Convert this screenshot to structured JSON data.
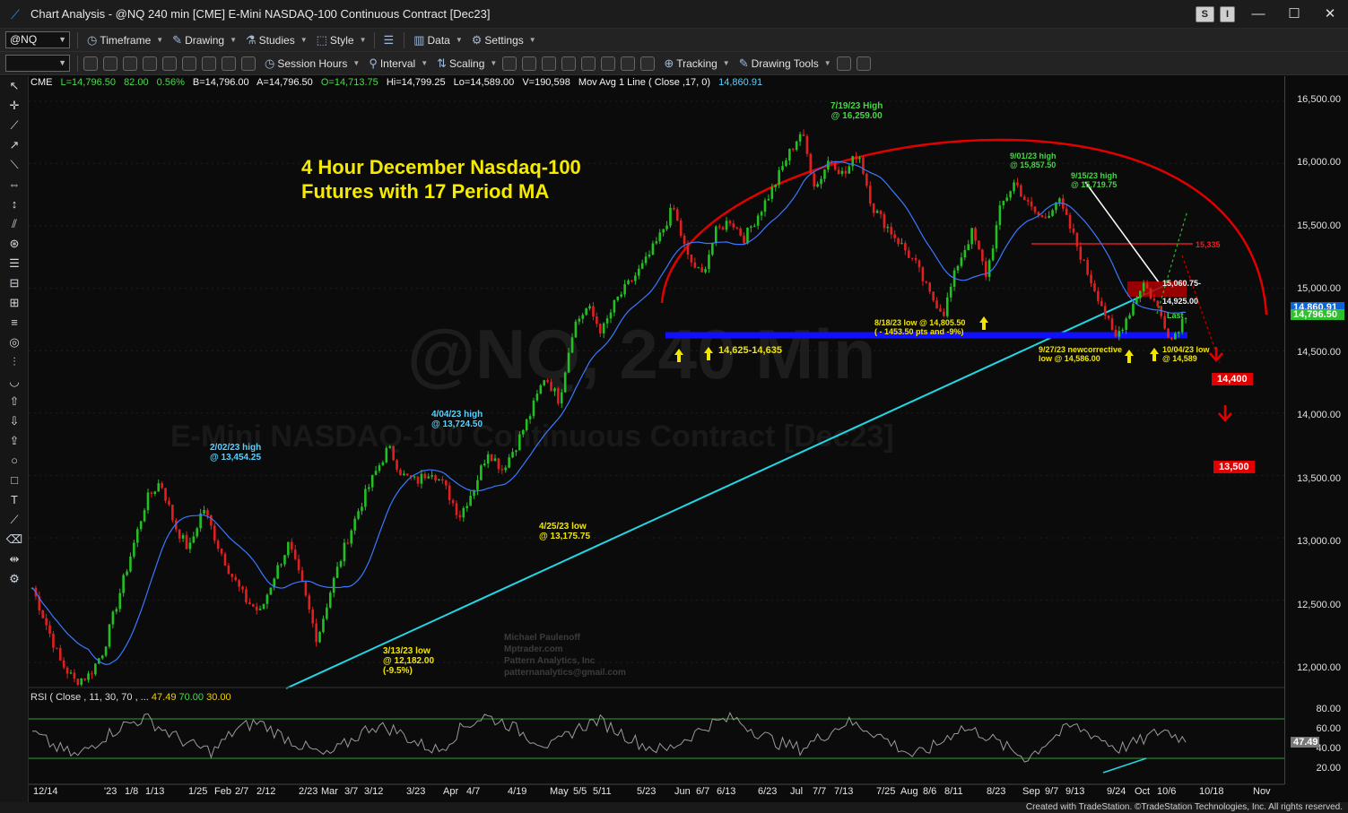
{
  "window": {
    "title": "Chart Analysis - @NQ 240 min [CME] E-Mini NASDAQ-100 Continuous Contract [Dec23]",
    "s_button": "S",
    "i_button": "I",
    "minimize": "—",
    "maximize": "☐",
    "close": "✕"
  },
  "toolbar1": {
    "symbol": "@NQ",
    "timeframe": "Timeframe",
    "drawing": "Drawing",
    "studies": "Studies",
    "style": "Style",
    "data": "Data",
    "settings": "Settings"
  },
  "toolbar2": {
    "session_hours": "Session Hours",
    "interval": "Interval",
    "scaling": "Scaling",
    "tracking": "Tracking",
    "drawing_tools": "Drawing Tools"
  },
  "status": {
    "exchange": "CME",
    "last": "L=14,796.50",
    "change": "82.00",
    "pct": "0.56%",
    "bid": "B=14,796.00",
    "ask": "A=14,796.50",
    "open": "O=14,713.75",
    "high": "Hi=14,799.25",
    "low": "Lo=14,589.00",
    "volume": "V=190,598",
    "ma_label": "Mov Avg 1 Line ( Close ,17, 0)",
    "ma_value": "14,860.91"
  },
  "rsi": {
    "label": "RSI ( Close , 11, 30, 70 , ...",
    "value": "47.49",
    "ob": "70.00",
    "os": "30.00"
  },
  "annotations": {
    "title1": "4 Hour December Nasdaq-100",
    "title2": "Futures with 17 Period MA",
    "high_719_a": "7/19/23 High",
    "high_719_b": "@ 16,259.00",
    "high_901_a": "9/01/23 high",
    "high_901_b": "@ 15,857.50",
    "high_915_a": "9/15/23 high",
    "high_915_b": "@ 15,719.75",
    "high_0202_a": "2/02/23 high",
    "high_0202_b": "@ 13,454.25",
    "high_0404_a": "4/04/23 high",
    "high_0404_b": "@ 13,724.50",
    "low_0425_a": "4/25/23 low",
    "low_0425_b": "@ 13,175.75",
    "low_0313_a": "3/13/23 low",
    "low_0313_b": "@ 12,182.00",
    "low_0313_c": "(-9.5%)",
    "support": "14,625-14,635",
    "low_0818_a": "8/18/23 low @ 14,805.50",
    "low_0818_b": "( - 1453.50 pts and -9%)",
    "low_0927_a": "9/27/23 newcorrective",
    "low_0927_b": "low @ 14,586.00",
    "low_1004_a": "10/04/23 low",
    "low_1004_b": "@ 14,589",
    "lvl_15335": "15,335",
    "lvl_15060": "15,060.75-",
    "lvl_14925": "14,925.00",
    "last_label": "Last",
    "target_14400": "14,400",
    "target_13500": "13,500",
    "credit1": "Michael Paulenoff",
    "credit2": "Mptrader.com",
    "credit3": "Pattern Analytics, Inc",
    "credit4": "patternanalytics@gmail.com",
    "watermark1": "@NQ, 240 Min",
    "watermark2": "E-Mini NASDAQ-100 Continuous Contract [Dec23]"
  },
  "price_axis": [
    "16,500.00",
    "16,000.00",
    "15,500.00",
    "15,000.00",
    "14,500.00",
    "14,000.00",
    "13,500.00",
    "13,000.00",
    "12,500.00",
    "12,000.00"
  ],
  "rsi_axis": [
    "80.00",
    "60.00",
    "40.00",
    "20.00"
  ],
  "axis_tags": {
    "ma": "14,860.91",
    "last": "14,796.50",
    "rsi": "47.49"
  },
  "dates": [
    "12/14",
    "'23",
    "1/8",
    "1/13",
    "1/25",
    "Feb",
    "2/7",
    "2/12",
    "2/23",
    "Mar",
    "3/7",
    "3/12",
    "3/23",
    "Apr",
    "4/7",
    "4/19",
    "May",
    "5/5",
    "5/11",
    "5/23",
    "Jun",
    "6/7",
    "6/13",
    "6/23",
    "Jul",
    "7/7",
    "7/13",
    "7/25",
    "Aug",
    "8/6",
    "8/11",
    "8/23",
    "Sep",
    "9/7",
    "9/13",
    "9/24",
    "Oct",
    "10/6",
    "10/18",
    "Nov"
  ],
  "footer": "Created with TradeStation. ©TradeStation Technologies, Inc. All rights reserved.",
  "colors": {
    "up": "#22c022",
    "down": "#e02020",
    "ma": "#3a78ff",
    "trend": "#22d6e6",
    "support": "#1010ff",
    "arc": "#e00000",
    "annot": "#f2e600"
  },
  "chart_data": {
    "type": "candlestick",
    "title": "4 Hour December Nasdaq-100 Futures with 17 Period MA",
    "ylim": [
      11800,
      16700
    ],
    "key_points": [
      {
        "label": "3/13/23 low",
        "y": 12182.0
      },
      {
        "label": "2/02/23 high",
        "y": 13454.25
      },
      {
        "label": "4/04/23 high",
        "y": 13724.5
      },
      {
        "label": "4/25/23 low",
        "y": 13175.75
      },
      {
        "label": "7/19/23 High",
        "y": 16259.0
      },
      {
        "label": "8/18/23 low",
        "y": 14805.5
      },
      {
        "label": "9/01/23 high",
        "y": 15857.5
      },
      {
        "label": "9/15/23 high",
        "y": 15719.75
      },
      {
        "label": "9/27/23 low",
        "y": 14586.0
      },
      {
        "label": "10/04/23 low",
        "y": 14589
      }
    ],
    "levels": [
      15335,
      15060.75,
      14925.0,
      14630,
      14400,
      13500
    ],
    "series": [
      {
        "values": [
          12600,
          12300,
          12000,
          11850,
          11900,
          12100,
          12500,
          12900,
          13300,
          13454,
          13100,
          12900,
          13250,
          12950,
          12700,
          12500,
          12400,
          12700,
          12950,
          12600,
          12182,
          12600,
          12950,
          13250,
          13500,
          13724,
          13500,
          13450,
          13550,
          13400,
          13175,
          13400,
          13700,
          13550,
          13750,
          14000,
          14300,
          14100,
          14700,
          14850,
          14650,
          14900,
          15050,
          15200,
          15400,
          15650,
          15250,
          15100,
          15450,
          15550,
          15400,
          15600,
          15800,
          16050,
          16259,
          15800,
          16050,
          15900,
          16100,
          15650,
          15500,
          15350,
          15200,
          14950,
          14805,
          15200,
          15450,
          15100,
          15650,
          15857,
          15650,
          15550,
          15719,
          15450,
          15150,
          14900,
          14586,
          14800,
          15050,
          14850,
          14589,
          14796
        ]
      }
    ],
    "rsi": [
      55,
      40,
      30,
      48,
      62,
      70,
      55,
      42,
      35,
      58,
      66,
      52,
      40,
      30,
      45,
      62,
      58,
      44,
      36,
      60,
      72,
      64,
      50,
      40,
      58,
      68,
      55,
      42,
      36,
      50,
      64,
      70,
      56,
      44,
      38,
      52,
      66,
      58,
      44,
      30,
      42,
      60,
      54,
      40,
      28,
      48,
      62,
      52,
      38,
      46,
      58,
      47
    ]
  }
}
